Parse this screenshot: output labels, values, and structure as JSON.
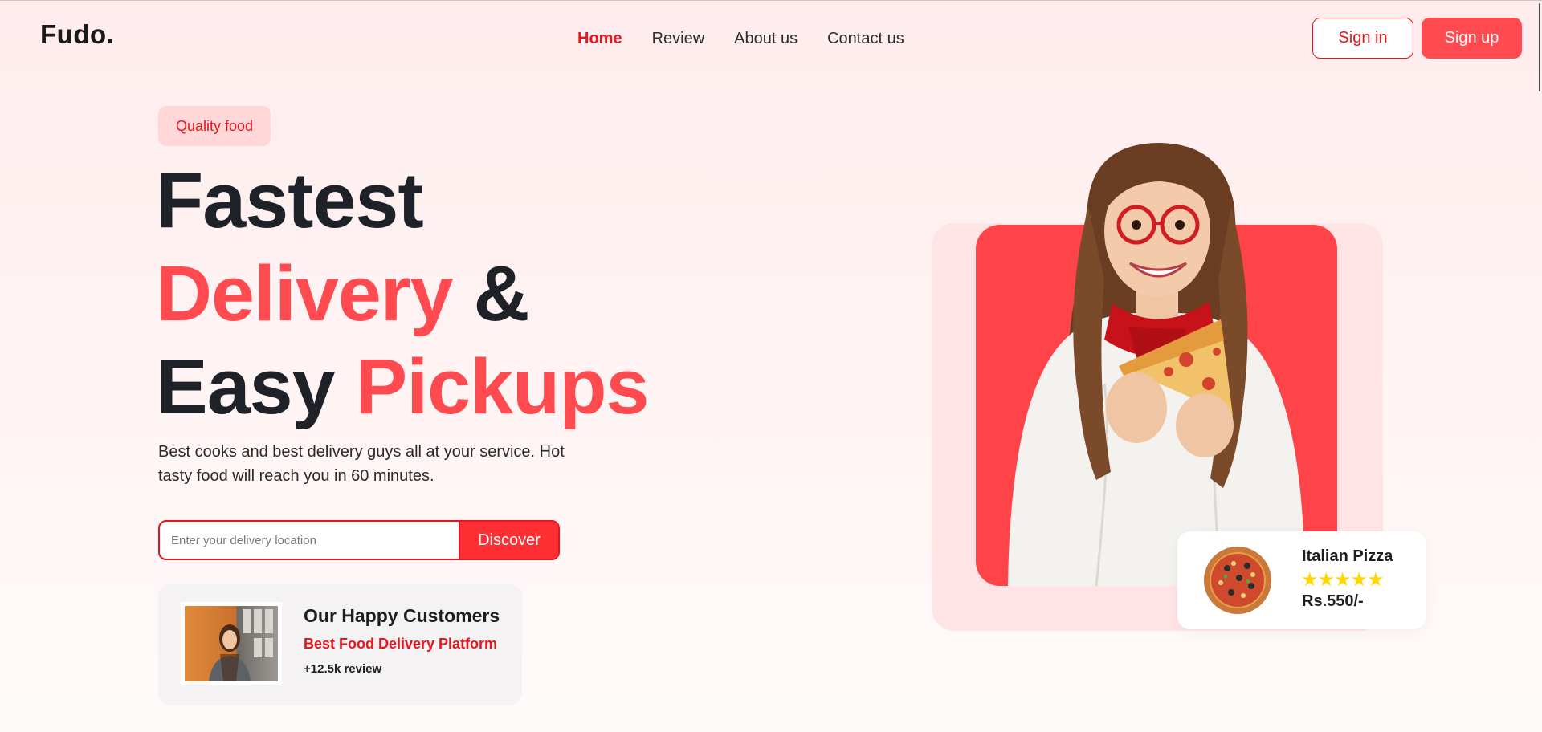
{
  "header": {
    "logo": "Fudo.",
    "nav": [
      {
        "label": "Home",
        "active": true
      },
      {
        "label": "Review",
        "active": false
      },
      {
        "label": "About us",
        "active": false
      },
      {
        "label": "Contact us",
        "active": false
      }
    ],
    "signin_label": "Sign in",
    "signup_label": "Sign up"
  },
  "hero": {
    "badge": "Quality food",
    "headline": {
      "line1": "Fastest",
      "line2_red": "Delivery",
      "line2_dark": " &",
      "line3_dark": "Easy ",
      "line3_red": "Pickups"
    },
    "description": "Best cooks and best delivery guys all at your service. Hot tasty food will reach you in 60 minutes.",
    "search": {
      "placeholder": "Enter your delivery location",
      "value": "",
      "button_label": "Discover"
    },
    "customers": {
      "title": "Our Happy Customers",
      "subtitle": "Best Food Delivery Platform",
      "review": "+12.5k review"
    }
  },
  "product": {
    "name": "Italian Pizza",
    "stars": "★★★★★",
    "rating": 5,
    "price": "Rs.550/-"
  },
  "colors": {
    "accent": "#e8141c",
    "accent_light": "#ff4a4f",
    "dark": "#1e2128",
    "badge_bg": "#ffd7d8",
    "star": "#ffd700"
  },
  "icons": [
    "customer-photo",
    "woman-eating-pizza-image",
    "pizza-image"
  ]
}
